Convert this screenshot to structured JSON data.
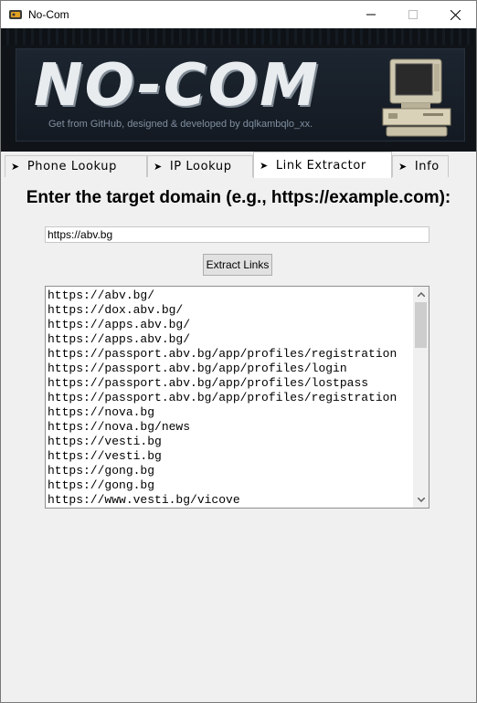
{
  "window": {
    "title": "No-Com",
    "icon": "app-icon"
  },
  "banner": {
    "logo": "NO-COM",
    "subtitle": "Get from GitHub, designed & developed by dqlkambqlo_xx.",
    "art": "retro-computer-icon"
  },
  "tabs": [
    {
      "label": "Phone Lookup",
      "icon": "arrow-icon",
      "active": false
    },
    {
      "label": "IP Lookup",
      "icon": "arrow-icon",
      "active": false
    },
    {
      "label": "Link Extractor",
      "icon": "arrow-icon",
      "active": true
    },
    {
      "label": "Info",
      "icon": "arrow-icon",
      "active": false
    }
  ],
  "tab_arrow": "➤",
  "main": {
    "heading": "Enter the target domain (e.g., https://example.com):",
    "domain_input": "https://abv.bg",
    "extract_button": "Extract Links",
    "results": [
      "https://abv.bg/",
      "https://dox.abv.bg/",
      "https://apps.abv.bg/",
      "https://apps.abv.bg/",
      "https://passport.abv.bg/app/profiles/registration",
      "https://passport.abv.bg/app/profiles/login",
      "https://passport.abv.bg/app/profiles/lostpass",
      "https://passport.abv.bg/app/profiles/registration",
      "https://nova.bg",
      "https://nova.bg/news",
      "https://vesti.bg",
      "https://vesti.bg",
      "https://gong.bg",
      "https://gong.bg",
      "https://www.vesti.bg/vicove"
    ]
  }
}
